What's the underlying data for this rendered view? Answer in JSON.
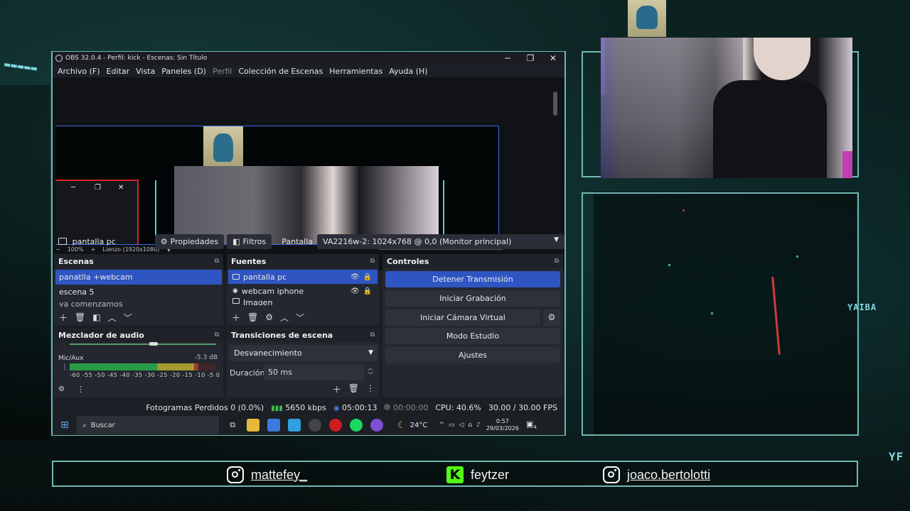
{
  "background": {
    "sign_text": "YAIBA",
    "sign_text_short": "YF"
  },
  "obs": {
    "window_title": "OBS 32.0.4 - Perfil: kick - Escenas: Sin Título",
    "window_buttons": [
      "─",
      "❐",
      "✕"
    ],
    "menu": [
      "Archivo (F)",
      "Editar",
      "Vista",
      "Paneles (D)",
      "Perfil",
      "Colección de Escenas",
      "Herramientas",
      "Ayuda (H)"
    ],
    "preview": {
      "zoom_minus": "−",
      "zoom": "100%",
      "zoom_plus": "+",
      "canvas_label": "Lienzo (1920x1080)"
    },
    "source_bar": {
      "source_name": "pantalla pc",
      "properties_label": "Propiedades",
      "filters_label": "Filtros",
      "display_label": "Pantalla",
      "display_value": "VA2216w-2: 1024x768 @ 0,0 (Monitor principal)"
    },
    "scenes": {
      "title": "Escenas",
      "items": [
        "panatlla +webcam",
        "escena 5",
        "ya comenzamos"
      ],
      "selected_index": 0
    },
    "sources": {
      "title": "Fuentes",
      "items": [
        {
          "name": "pantalla pc",
          "icon": "monitor-icon"
        },
        {
          "name": "webcam iphone",
          "icon": "camera-icon"
        },
        {
          "name": "Imagen",
          "icon": "image-icon"
        }
      ]
    },
    "controls": {
      "title": "Controles",
      "stop_stream": "Detener Transmisión",
      "start_recording": "Iniciar Grabación",
      "start_virtual_cam": "Iniciar Cámara Virtual",
      "studio_mode": "Modo Estudio",
      "settings": "Ajustes"
    },
    "mixer": {
      "title": "Mezclador de audio",
      "channel": "Mic/Aux",
      "level": "-5.3 dB",
      "scale": "-60 -55 -50 -45 -40 -35 -30 -25 -20 -15 -10 -5 0",
      "meter_fraction": 0.88
    },
    "transitions": {
      "title": "Transiciones de escena",
      "type": "Desvanecimiento",
      "duration_label": "Duración",
      "duration_value": "50 ms"
    },
    "status": {
      "dropped_frames": "Fotogramas Perdidos 0 (0.0%)",
      "bitrate": "5650 kbps",
      "stream_time": "05:00:13",
      "record_time": "00:00:00",
      "cpu": "CPU: 40.6%",
      "fps": "30.00 / 30.00 FPS"
    }
  },
  "taskbar": {
    "search_placeholder": "Buscar",
    "temperature": "24°C",
    "time": "0:57",
    "date": "29/03/2026",
    "notification_count": "4"
  },
  "social": {
    "instagram_1": "mattefey_",
    "kick": "feytzer",
    "instagram_2": "joaco.bertolotti"
  },
  "colors": {
    "frame": "#6fb8b4",
    "obs_accent": "#2f55c2",
    "kick_green": "#53fc18"
  }
}
